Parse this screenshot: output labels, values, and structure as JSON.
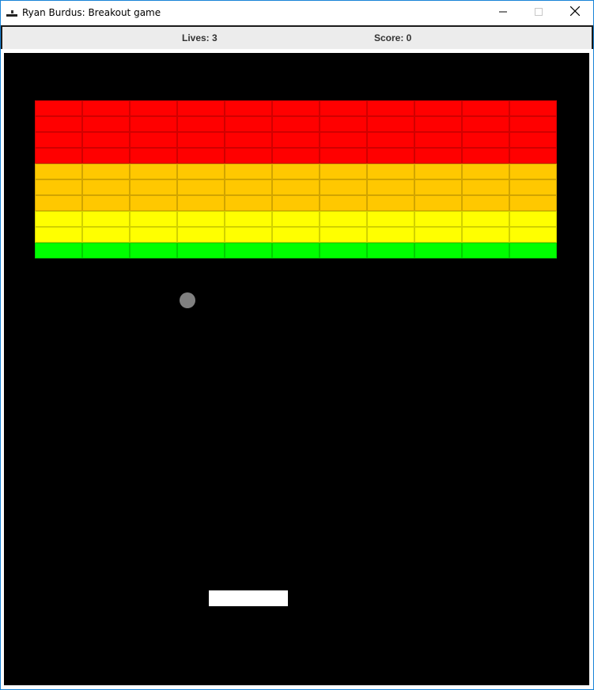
{
  "window": {
    "title": "Ryan Burdus: Breakout game",
    "controls": {
      "minimize_icon": "minimize-icon",
      "maximize_icon": "maximize-icon",
      "close_icon": "close-icon"
    }
  },
  "status": {
    "lives_label": "Lives: 3",
    "score_label": "Score: 0"
  },
  "game": {
    "background_color": "#000000",
    "brick_rows": [
      {
        "color": "#ff0000",
        "count": 11
      },
      {
        "color": "#ff0000",
        "count": 11
      },
      {
        "color": "#ff0000",
        "count": 11
      },
      {
        "color": "#ff0000",
        "count": 11
      },
      {
        "color": "#ffc800",
        "count": 11
      },
      {
        "color": "#ffc800",
        "count": 11
      },
      {
        "color": "#ffc800",
        "count": 11
      },
      {
        "color": "#ffff00",
        "count": 11
      },
      {
        "color": "#ffff00",
        "count": 11
      },
      {
        "color": "#00ff00",
        "count": 11
      }
    ],
    "ball_color": "#808080",
    "paddle_color": "#ffffff"
  }
}
